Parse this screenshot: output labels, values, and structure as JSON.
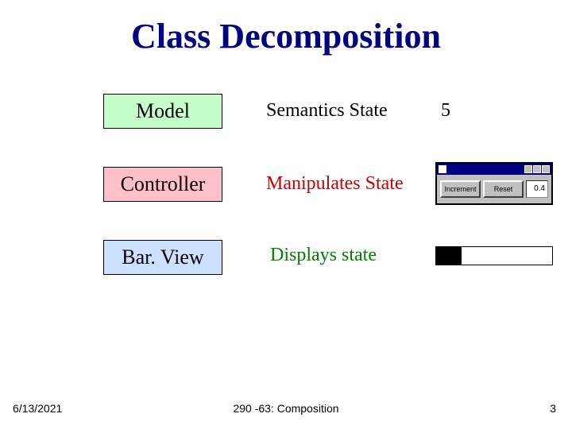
{
  "title": "Class Decomposition",
  "rows": [
    {
      "box": "Model",
      "box_class": "green",
      "desc": "Semantics State",
      "desc_class": "black",
      "value": "5"
    },
    {
      "box": "Controller",
      "box_class": "pink",
      "desc": "Manipulates State",
      "desc_class": "red"
    },
    {
      "box": "Bar. View",
      "box_class": "blue",
      "desc": "Displays state",
      "desc_class": "green"
    }
  ],
  "mini_window": {
    "title_icon": "app-icon",
    "btn1": "Increment",
    "btn2": "Reset",
    "value": "0.4"
  },
  "bar_fill_percent": 22,
  "footer": {
    "date": "6/13/2021",
    "center": "290 -63: Composition",
    "page": "3"
  }
}
